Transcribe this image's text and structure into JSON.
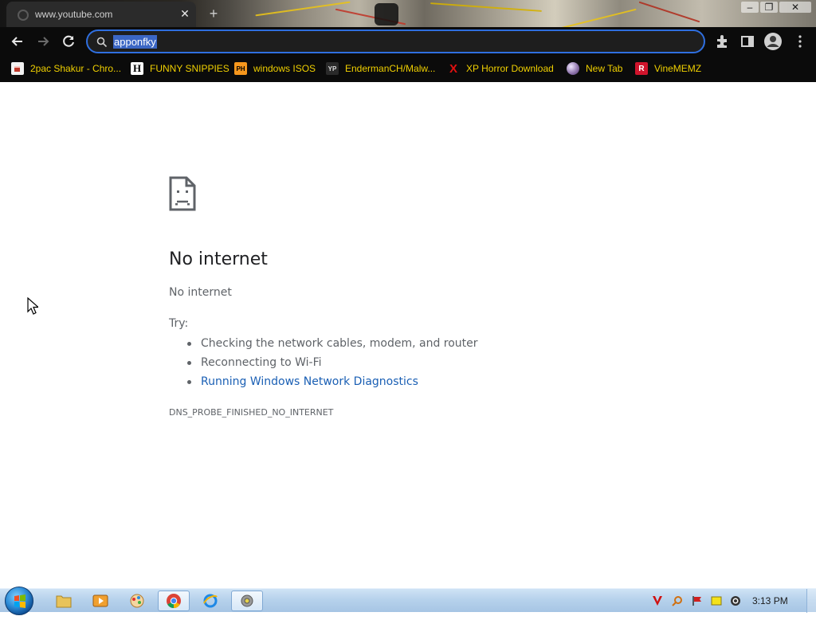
{
  "tab": {
    "title": "www.youtube.com",
    "close_glyph": "✕",
    "newtab_glyph": "+"
  },
  "window_buttons": {
    "minimize": "–",
    "restore": "❐",
    "close": "✕"
  },
  "omnibox": {
    "value": "apponfky"
  },
  "bookmarks": [
    {
      "label": "2pac Shakur - Chro...",
      "icon_text": "",
      "icon": "cup-icon",
      "color": "#c0392b"
    },
    {
      "label": "FUNNY SNIPPIES",
      "icon_text": "H",
      "icon": "h-logo-icon",
      "color": "#ffffff"
    },
    {
      "label": "windows ISOS",
      "icon_text": "PH",
      "icon": "ph-logo-icon",
      "color": "#f7971d"
    },
    {
      "label": "EndermanCH/Malw...",
      "icon_text": "YP",
      "icon": "yp-logo-icon",
      "color": "#333333"
    },
    {
      "label": "XP Horror Download",
      "icon_text": "X",
      "icon": "x-logo-icon",
      "color": "#e01010"
    },
    {
      "label": "New Tab",
      "icon_text": "",
      "icon": "globe-icon",
      "color": "#8a6fa8"
    },
    {
      "label": "VineMEMZ",
      "icon_text": "R",
      "icon": "r-logo-icon",
      "color": "#d0142c"
    }
  ],
  "error_page": {
    "title": "No internet",
    "subtitle": "No internet",
    "try_label": "Try:",
    "suggestions": [
      "Checking the network cables, modem, and router",
      "Reconnecting to Wi-Fi",
      "Running Windows Network Diagnostics"
    ],
    "error_code": "DNS_PROBE_FINISHED_NO_INTERNET"
  },
  "taskbar": {
    "clock": "3:13 PM",
    "pinned": [
      "folder-icon",
      "media-player-icon",
      "paint-icon",
      "chrome-icon",
      "ie-icon",
      "disc-app-icon"
    ],
    "tray": [
      "v-app-icon",
      "search-tray-icon",
      "flag-icon",
      "notes-icon",
      "volume-icon"
    ]
  },
  "colors": {
    "accent": "#2f6fe0",
    "link": "#1a5fb4",
    "bookmark_text": "#f0d000"
  }
}
